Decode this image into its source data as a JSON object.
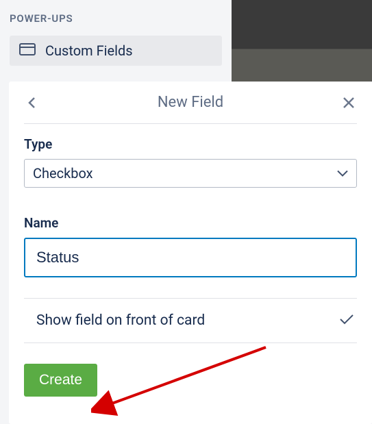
{
  "sidebar": {
    "sectionTitle": "POWER-UPS",
    "item": {
      "label": "Custom Fields"
    }
  },
  "modal": {
    "title": "New Field",
    "typeLabel": "Type",
    "typeValue": "Checkbox",
    "nameLabel": "Name",
    "nameValue": "Status",
    "showFrontLabel": "Show field on front of card",
    "createLabel": "Create"
  }
}
